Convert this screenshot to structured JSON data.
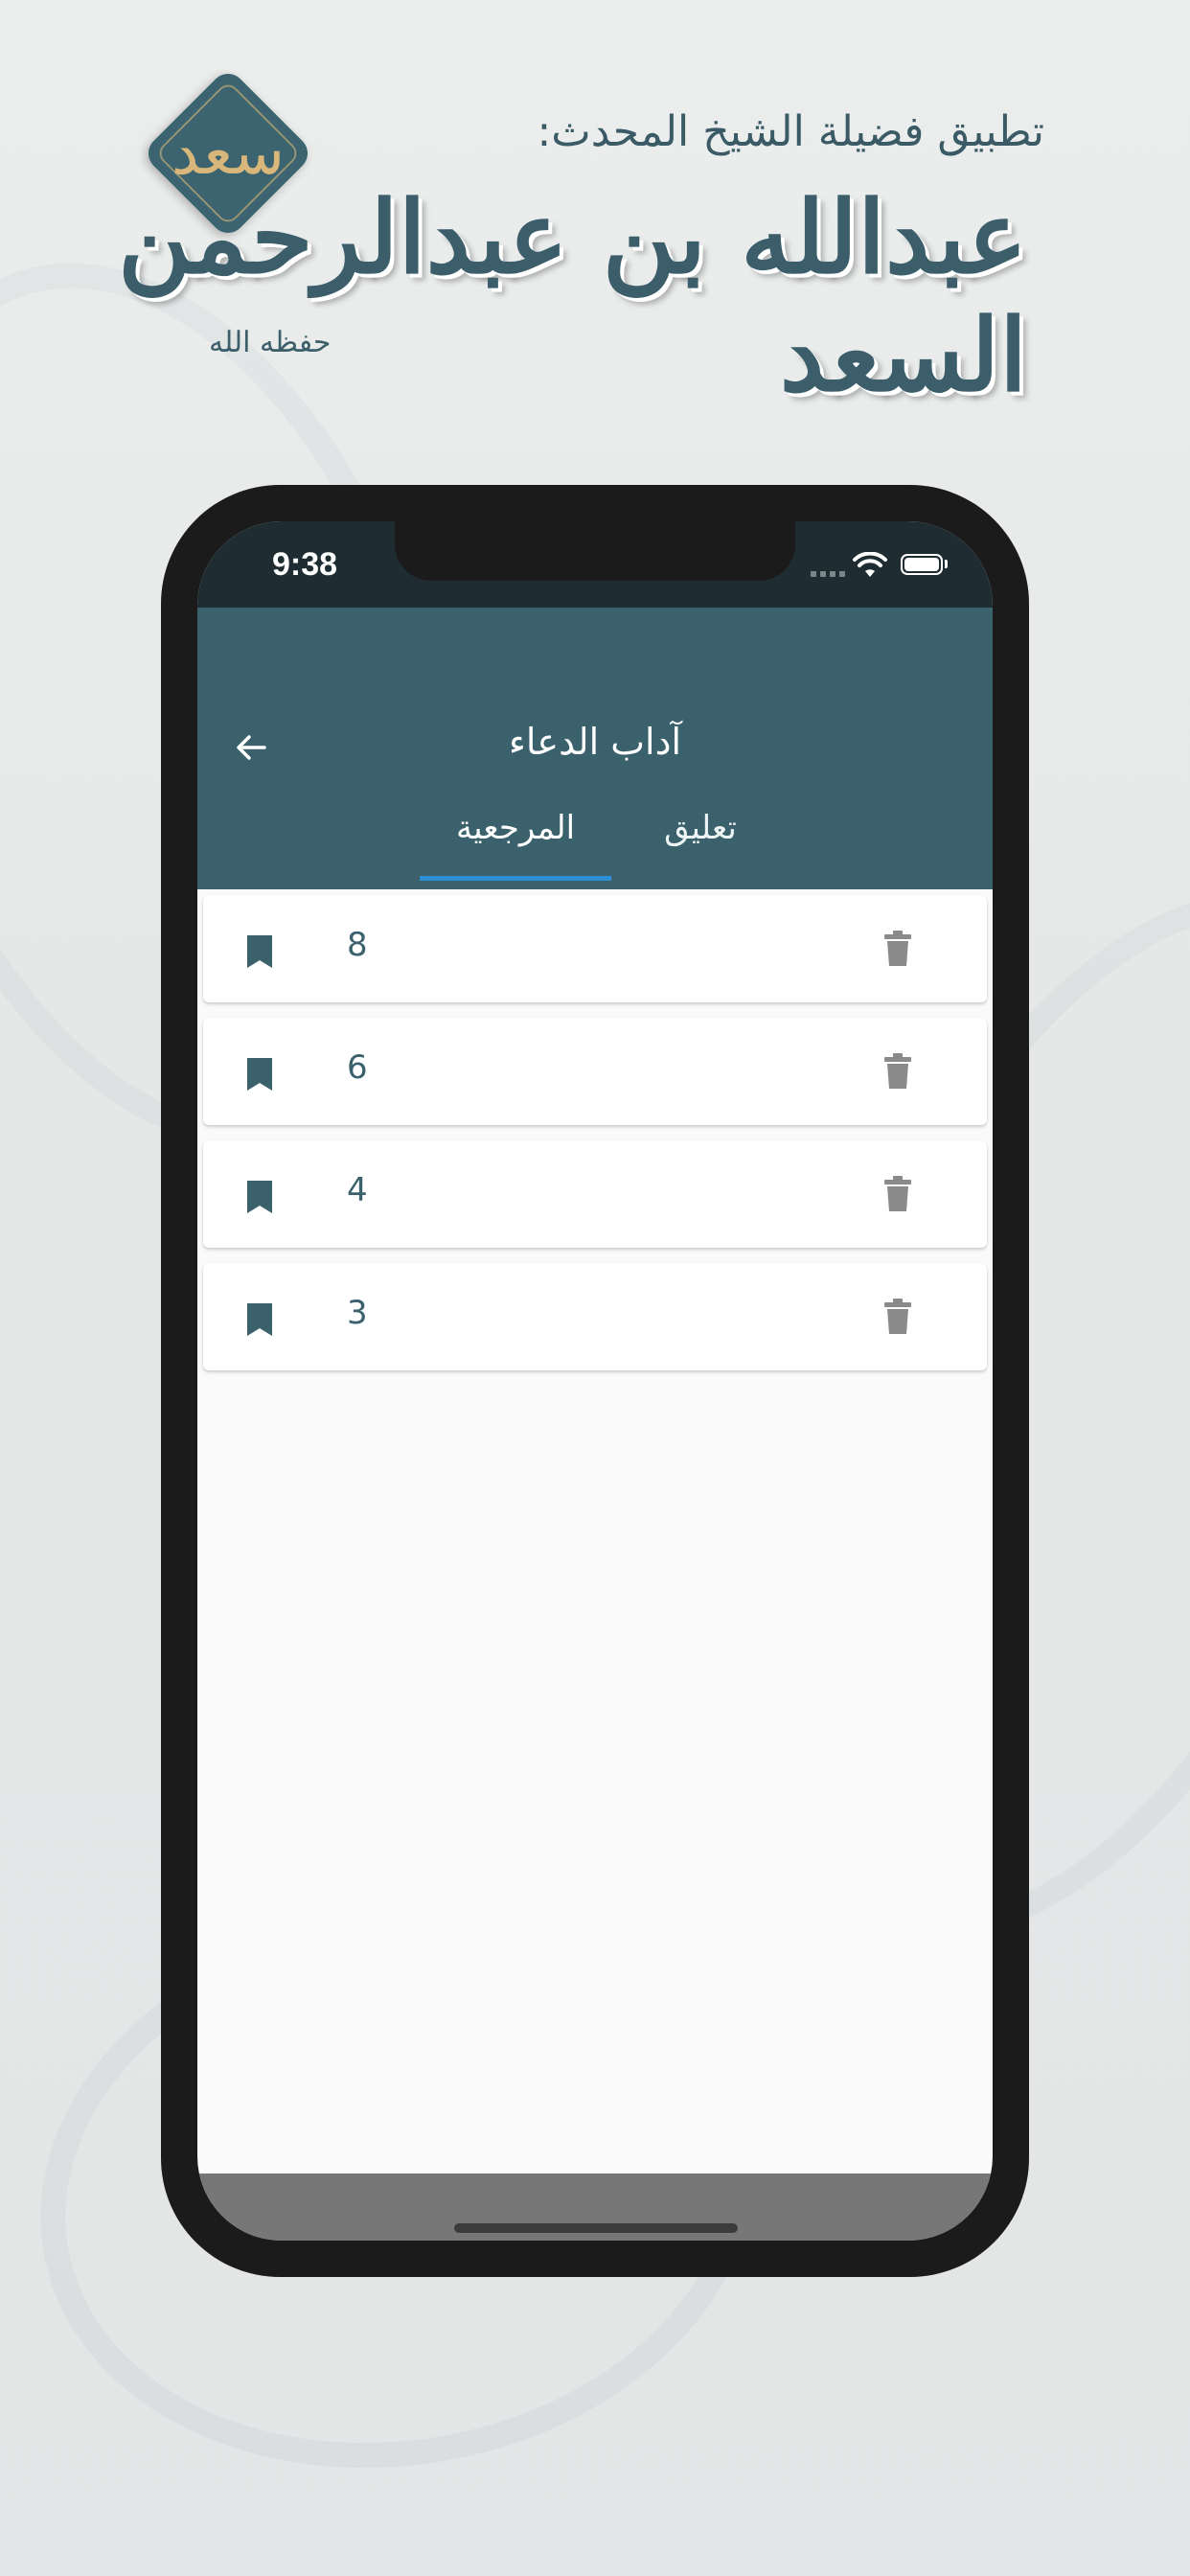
{
  "promo": {
    "subtitle": "تطبيق فضيلة الشيخ المحدث:",
    "name": "عبدالله بن عبدالرحمن السعد",
    "tag": "حفظه الله",
    "logo_text": "سعد"
  },
  "status_bar": {
    "time": "9:38"
  },
  "app_bar": {
    "title": "آداب الدعاء",
    "tabs": [
      {
        "label": "المرجعية",
        "selected": true
      },
      {
        "label": "تعليق",
        "selected": false
      }
    ]
  },
  "bookmarks": [
    {
      "number": "8"
    },
    {
      "number": "6"
    },
    {
      "number": "4"
    },
    {
      "number": "3"
    }
  ],
  "colors": {
    "app_bar": "#3a616c",
    "status_bar": "#1f2d32",
    "tab_indicator": "#2f8fd6",
    "bookmark_icon": "#3a616c",
    "trash_icon": "#8a8a8a"
  },
  "icons": {
    "back": "arrow-back-icon",
    "bookmark": "bookmark-icon",
    "delete": "trash-icon"
  }
}
